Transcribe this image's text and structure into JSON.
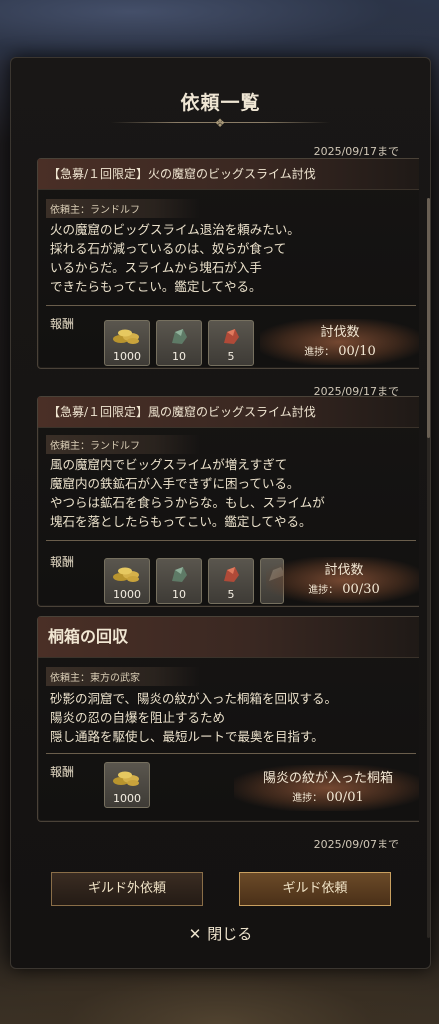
{
  "title": "依頼一覧",
  "quests": [
    {
      "deadline": "2025/09/17まで",
      "name": "【急募/１回限定】火の魔窟のビッグスライム討伐",
      "client": "依頼主：ランドルフ",
      "description": "火の魔窟のビッグスライム退治を頼みたい。\n採れる石が減っているのは、奴らが食って\nいるからだ。スライムから塊石が入手\nできたらもってこい。鑑定してやる。",
      "reward_label": "報酬",
      "rewards": [
        {
          "icon": "gold-coins-icon",
          "count": "1000"
        },
        {
          "icon": "green-ore-icon",
          "count": "10"
        },
        {
          "icon": "red-ore-icon",
          "count": "5"
        }
      ],
      "goal_name": "討伐数",
      "progress_label": "進捗：",
      "progress": "00/10"
    },
    {
      "deadline": "2025/09/17まで",
      "name": "【急募/１回限定】風の魔窟のビッグスライム討伐",
      "client": "依頼主：ランドルフ",
      "description": "風の魔窟内でビッグスライムが増えすぎて\n魔窟内の鉄鉱石が入手できずに困っている。\nやつらは鉱石を食らうからな。もし、スライムが\n塊石を落としたらもってこい。鑑定してやる。",
      "reward_label": "報酬",
      "rewards": [
        {
          "icon": "gold-coins-icon",
          "count": "1000"
        },
        {
          "icon": "green-ore-icon",
          "count": "10"
        },
        {
          "icon": "red-ore-icon",
          "count": "5"
        }
      ],
      "goal_name": "討伐数",
      "progress_label": "進捗：",
      "progress": "00/30"
    },
    {
      "deadline": "",
      "name": "桐箱の回収",
      "client": "依頼主：東方の武家",
      "description": "砂影の洞窟で、陽炎の紋が入った桐箱を回収する。\n陽炎の忍の自爆を阻止するため\n隠し通路を駆使し、最短ルートで最奥を目指す。",
      "reward_label": "報酬",
      "rewards": [
        {
          "icon": "gold-coins-icon",
          "count": "1000"
        }
      ],
      "goal_name": "陽炎の紋が入った桐箱",
      "progress_label": "進捗：",
      "progress": "00/01"
    }
  ],
  "next_deadline": "2025/09/07まで",
  "buttons": {
    "outside": "ギルド外依頼",
    "guild": "ギルド依頼",
    "close": "閉じる"
  },
  "colors": {
    "panel": "#141211",
    "header_accent": "#4a2f26",
    "goal_glow": "#96583c",
    "guild_button": "#6b4a28"
  }
}
